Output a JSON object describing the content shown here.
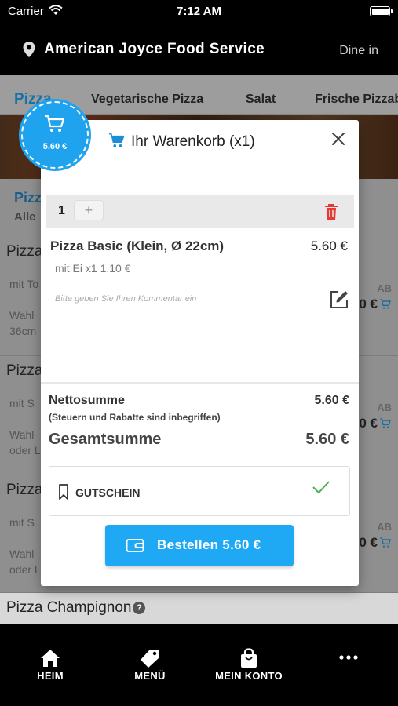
{
  "status_bar": {
    "carrier": "Carrier",
    "time": "7:12 AM"
  },
  "header": {
    "restaurant": "American Joyce Food Service",
    "mode": "Dine in"
  },
  "categories": [
    "Pizza",
    "Vegetarische Pizza",
    "Salat",
    "Frische Pizzabr"
  ],
  "section": {
    "title": "Pizz",
    "subtitle": "Alle"
  },
  "products": [
    {
      "name": "Pizza",
      "line1": "mit To",
      "line2a": "Wahl",
      "line2b": "36cm",
      "ab": "AB",
      "price": "0 €"
    },
    {
      "name": "Pizza",
      "line1": "mit S",
      "line2a": "Wahl",
      "line2b": "oder L",
      "ab": "AB",
      "price": "0 €"
    },
    {
      "name": "Pizza",
      "line1": "mit S",
      "line2a": "Wahl",
      "line2b": "oder L",
      "ab": "AB",
      "price": "0 €"
    }
  ],
  "last_product": {
    "name": "Pizza Champignon"
  },
  "cart_badge": {
    "amount": "5.60 €"
  },
  "cart": {
    "title": "Ihr Warenkorb (x1)",
    "quantity": "1",
    "plus": "+",
    "item_name": "Pizza Basic (Klein, Ø 22cm)",
    "item_price": "5.60 €",
    "item_option": "mit Ei x1 1.10 €",
    "comment_placeholder": "Bitte geben Sie Ihren Kommentar ein",
    "net_label": "Nettosumme",
    "net_value": "5.60 €",
    "net_note": "(Steuern und Rabatte sind inbegriffen)",
    "total_label": "Gesamtsumme",
    "total_value": "5.60 €",
    "voucher_label": "GUTSCHEIN",
    "order_button": "Bestellen 5.60 €"
  },
  "tab_bar": [
    {
      "label": "HEIM",
      "icon": "home-icon"
    },
    {
      "label": "MENÜ",
      "icon": "tag-icon"
    },
    {
      "label": "MEIN KONTO",
      "icon": "bag-icon"
    },
    {
      "label": "",
      "icon": "more-icon"
    }
  ],
  "colors": {
    "accent": "#1fa8f4",
    "delete": "#e53935",
    "check": "#4caf50"
  }
}
